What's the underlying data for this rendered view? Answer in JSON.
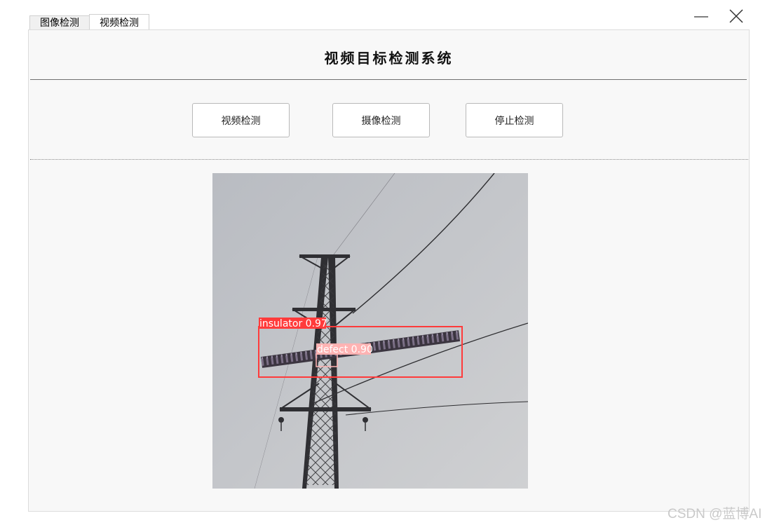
{
  "tabs": [
    {
      "label": "图像检测"
    },
    {
      "label": "视频检测"
    }
  ],
  "title": "视频目标检测系统",
  "buttons": {
    "video": "视频检测",
    "camera": "摄像检测",
    "stop": "停止检测"
  },
  "detections": [
    {
      "label": "insulator 0.97"
    },
    {
      "label": "defect 0.90"
    }
  ],
  "colors": {
    "detection_box": "#ff3b3b",
    "detection_label_bg": "#ff3b3b",
    "panel_bg": "#f8f8f8"
  },
  "watermark": "CSDN @蓝博AI"
}
